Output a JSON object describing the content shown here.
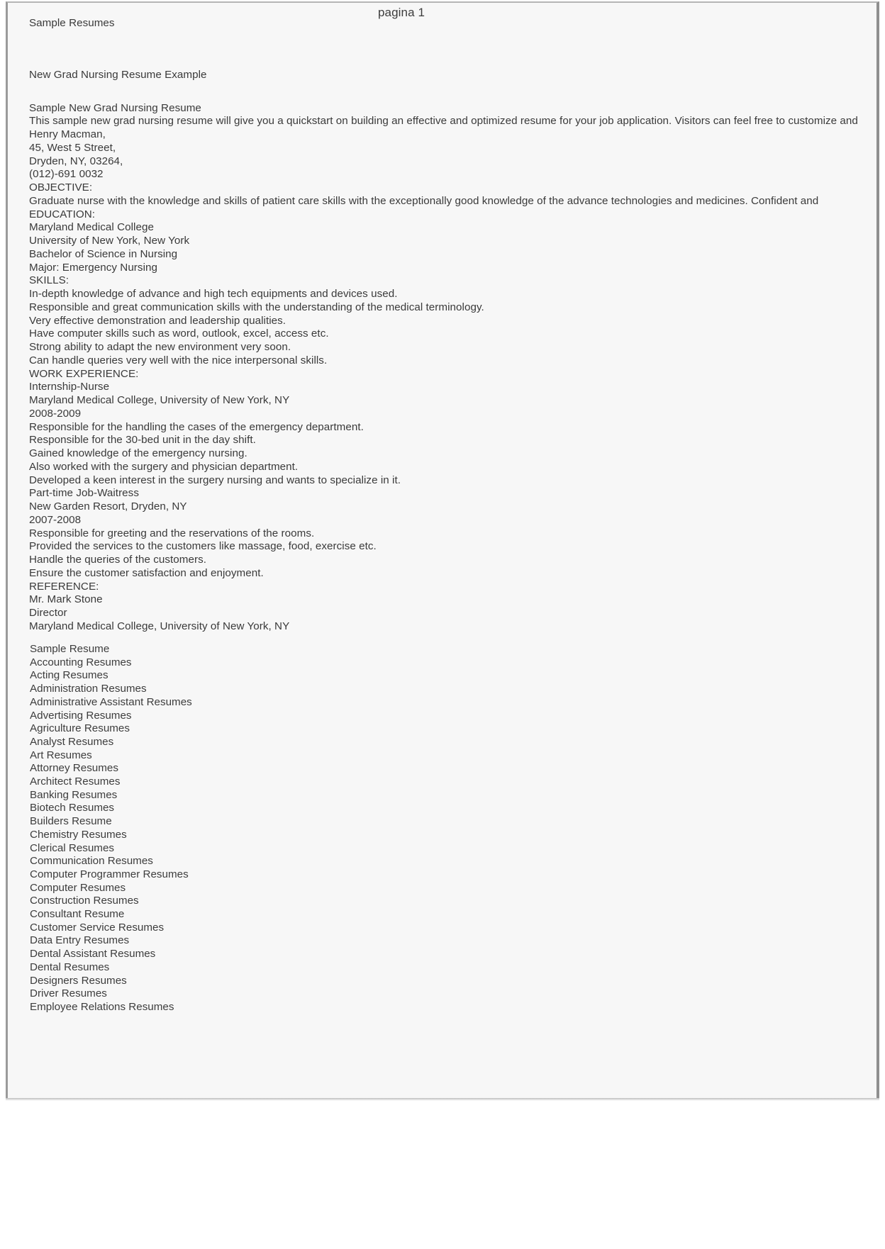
{
  "page": {
    "label": "pagina 1"
  },
  "document": {
    "site_title": "Sample Resumes",
    "heading": "New Grad Nursing Resume Example",
    "subheading": "Sample New Grad Nursing Resume",
    "intro": "This sample new grad nursing resume will give you a quickstart on building an effective and optimized resume for your job application. Visitors can feel free to customize and",
    "contact": [
      "Henry Macman,",
      "45, West 5 Street,",
      "Dryden, NY, 03264,",
      "(012)-691 0032"
    ],
    "sections": [
      {
        "heading": "OBJECTIVE:",
        "lines": [
          "Graduate nurse with the knowledge and skills of patient care skills with the exceptionally good knowledge of the advance technologies and medicines. Confident and"
        ]
      },
      {
        "heading": "EDUCATION:",
        "lines": [
          "Maryland Medical College",
          "University of New York, New York",
          "Bachelor of Science in Nursing",
          "Major: Emergency Nursing"
        ]
      },
      {
        "heading": "SKILLS:",
        "lines": [
          "In-depth knowledge of advance and high tech equipments and devices used.",
          "Responsible and great communication skills with the understanding of the medical terminology.",
          "Very effective demonstration and leadership qualities.",
          "Have computer skills such as word, outlook, excel, access etc.",
          "Strong ability to adapt the new environment very soon.",
          "Can handle queries very well with the nice interpersonal skills."
        ]
      },
      {
        "heading": "WORK EXPERIENCE:",
        "lines": [
          "Internship-Nurse",
          "Maryland Medical College, University of New York, NY",
          "2008-2009",
          "Responsible for the handling the cases of the emergency department.",
          "Responsible for the 30-bed unit in the day shift.",
          "Gained knowledge of the emergency nursing.",
          "Also worked with the surgery and physician department.",
          "Developed a keen interest in the surgery nursing and wants to specialize in it.",
          "Part-time Job-Waitress",
          "New Garden Resort, Dryden, NY",
          "2007-2008",
          "Responsible for greeting and the reservations of the rooms.",
          "Provided the services to the customers like massage, food, exercise etc.",
          "Handle the queries of the customers.",
          "Ensure the customer satisfaction and enjoyment."
        ]
      },
      {
        "heading": "REFERENCE:",
        "lines": [
          "Mr. Mark Stone",
          "Director",
          "Maryland Medical College, University of New York, NY"
        ]
      }
    ]
  },
  "categories": [
    "Sample Resume",
    "Accounting Resumes",
    "Acting Resumes",
    "Administration Resumes",
    "Administrative Assistant Resumes",
    "Advertising Resumes",
    "Agriculture Resumes",
    "Analyst Resumes",
    "Art Resumes",
    "Attorney Resumes",
    "Architect Resumes",
    "Banking Resumes",
    "Biotech Resumes",
    "Builders Resume",
    "Chemistry Resumes",
    "Clerical Resumes",
    "Communication Resumes",
    "Computer Programmer Resumes",
    "Computer Resumes",
    "Construction Resumes",
    "Consultant Resume",
    "Customer Service Resumes",
    "Data Entry Resumes",
    "Dental Assistant Resumes",
    "Dental Resumes",
    "Designers Resumes",
    "Driver Resumes",
    "Employee Relations Resumes"
  ]
}
